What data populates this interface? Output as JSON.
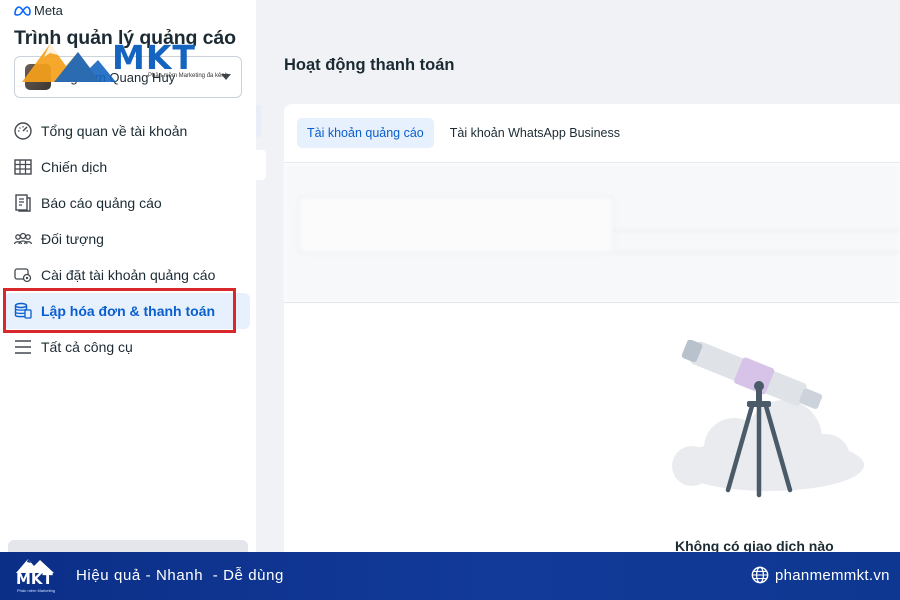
{
  "brand": {
    "name": "Meta"
  },
  "app": {
    "title": "Trình quản lý quảng cáo"
  },
  "account": {
    "name": "Nghiêm Quang Huy"
  },
  "nav": {
    "items": [
      {
        "label": "Tổng quan về tài khoản",
        "icon": "dashboard-gauge-icon"
      },
      {
        "label": "Chiến dịch",
        "icon": "table-grid-icon"
      },
      {
        "label": "Báo cáo quảng cáo",
        "icon": "report-pages-icon"
      },
      {
        "label": "Đối tượng",
        "icon": "people-group-icon"
      },
      {
        "label": "Cài đặt tài khoản quảng cáo",
        "icon": "account-settings-icon"
      },
      {
        "label": "Lập hóa đơn & thanh toán",
        "icon": "billing-stack-icon",
        "active": true
      },
      {
        "label": "Tất cả công cụ",
        "icon": "menu-lines-icon"
      }
    ]
  },
  "main": {
    "title": "Hoạt động thanh toán",
    "tabs": [
      {
        "label": "Tài khoản quảng cáo",
        "active": true
      },
      {
        "label": "Tài khoản WhatsApp Business",
        "active": false
      }
    ],
    "empty_state": {
      "text": "Không có giao dịch nào"
    }
  },
  "watermark": {
    "logo_text": "MKT",
    "logo_tagline": "Phần mềm Marketing đa kênh"
  },
  "banner": {
    "logo_text": "MKT",
    "logo_sub": "Phần mềm Marketing",
    "tagline": "Hiệu quả - Nhanh  - Dễ dùng",
    "website": "phanmemmkt.vn",
    "website_icon": "globe-icon"
  },
  "colors": {
    "accent": "#0a5fce",
    "active_bg": "#e7f0fd",
    "highlight_border": "#d9282b",
    "banner_bg": "#0b2f87"
  }
}
